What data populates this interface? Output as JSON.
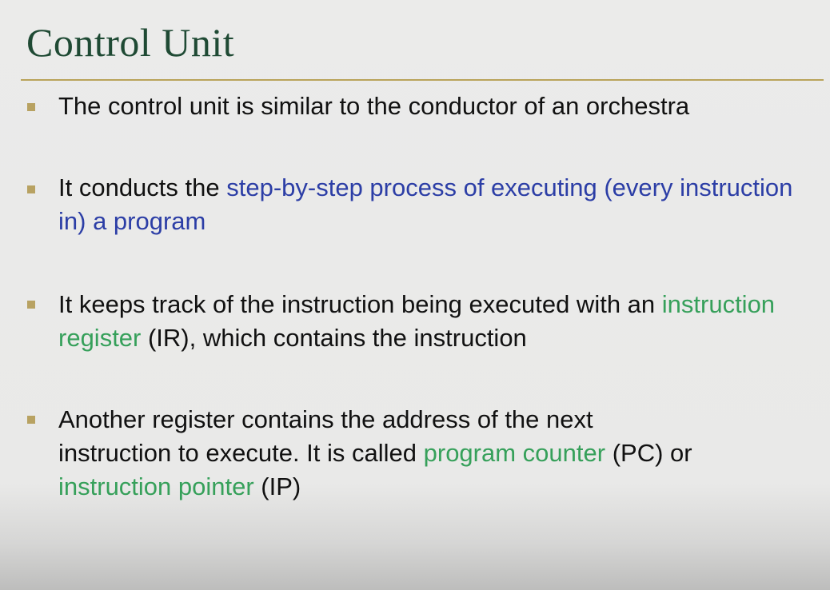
{
  "slide": {
    "title": "Control Unit",
    "bullets": [
      {
        "text": "The control unit is similar to the conductor of an orchestra"
      },
      {
        "before": "It conducts the ",
        "highlight": "step-by-step process of executing (every instruction in) a program"
      },
      {
        "before": "It keeps track of the instruction being executed with an ",
        "highlight": "instruction register",
        "after": " (IR), which contains the instruction"
      },
      {
        "line1": "Another register contains the address of the next",
        "line2_before": "instruction to execute. It is called ",
        "highlight1": "program counter",
        "mid": " (PC) or",
        "highlight2": "instruction pointer",
        "after": " (IP)"
      }
    ]
  },
  "colors": {
    "title": "#1f4a34",
    "rule": "#b9a35a",
    "bullet_marker": "#b8a262",
    "blue_highlight": "#2c3ea6",
    "green_highlight": "#36a05a"
  }
}
